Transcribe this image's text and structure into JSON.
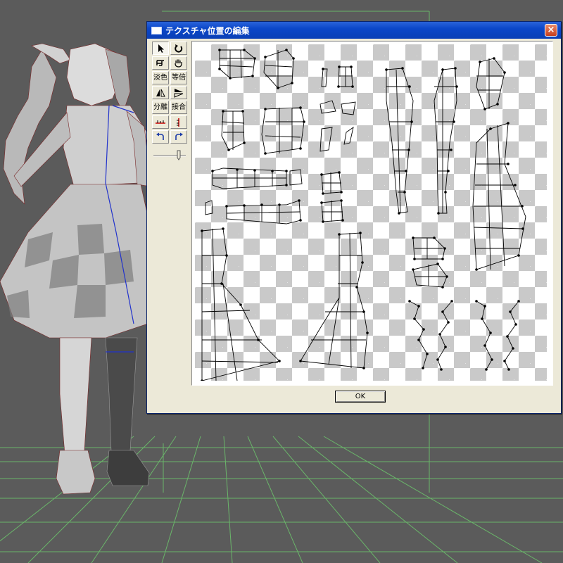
{
  "window": {
    "title": "テクスチャ位置の編集",
    "close_label": "×",
    "ok_label": "OK"
  },
  "toolbar": {
    "rows": [
      {
        "left": "select-arrow-icon",
        "right": "rotate-icon"
      },
      {
        "left": "move-icon",
        "right": "hand-pan-icon"
      },
      {
        "left_label": "淡色",
        "right_label": "等倍"
      },
      {
        "left": "flip-horizontal-icon",
        "right": "flip-vertical-icon"
      },
      {
        "left_label": "分離",
        "right_label": "接合"
      },
      {
        "left": "horizontal-align-icon",
        "right": "vertical-align-icon"
      },
      {
        "left": "undo-icon",
        "right": "redo-icon"
      }
    ],
    "slider": "zoom-slider"
  },
  "colors": {
    "viewport_bg": "#5b5b5b",
    "grid": "#7ee07e",
    "mesh_edge": "#8b1a1a",
    "seam": "#2233cc",
    "titlebar": "#0b47c9",
    "dialog_bg": "#ece9d8"
  }
}
